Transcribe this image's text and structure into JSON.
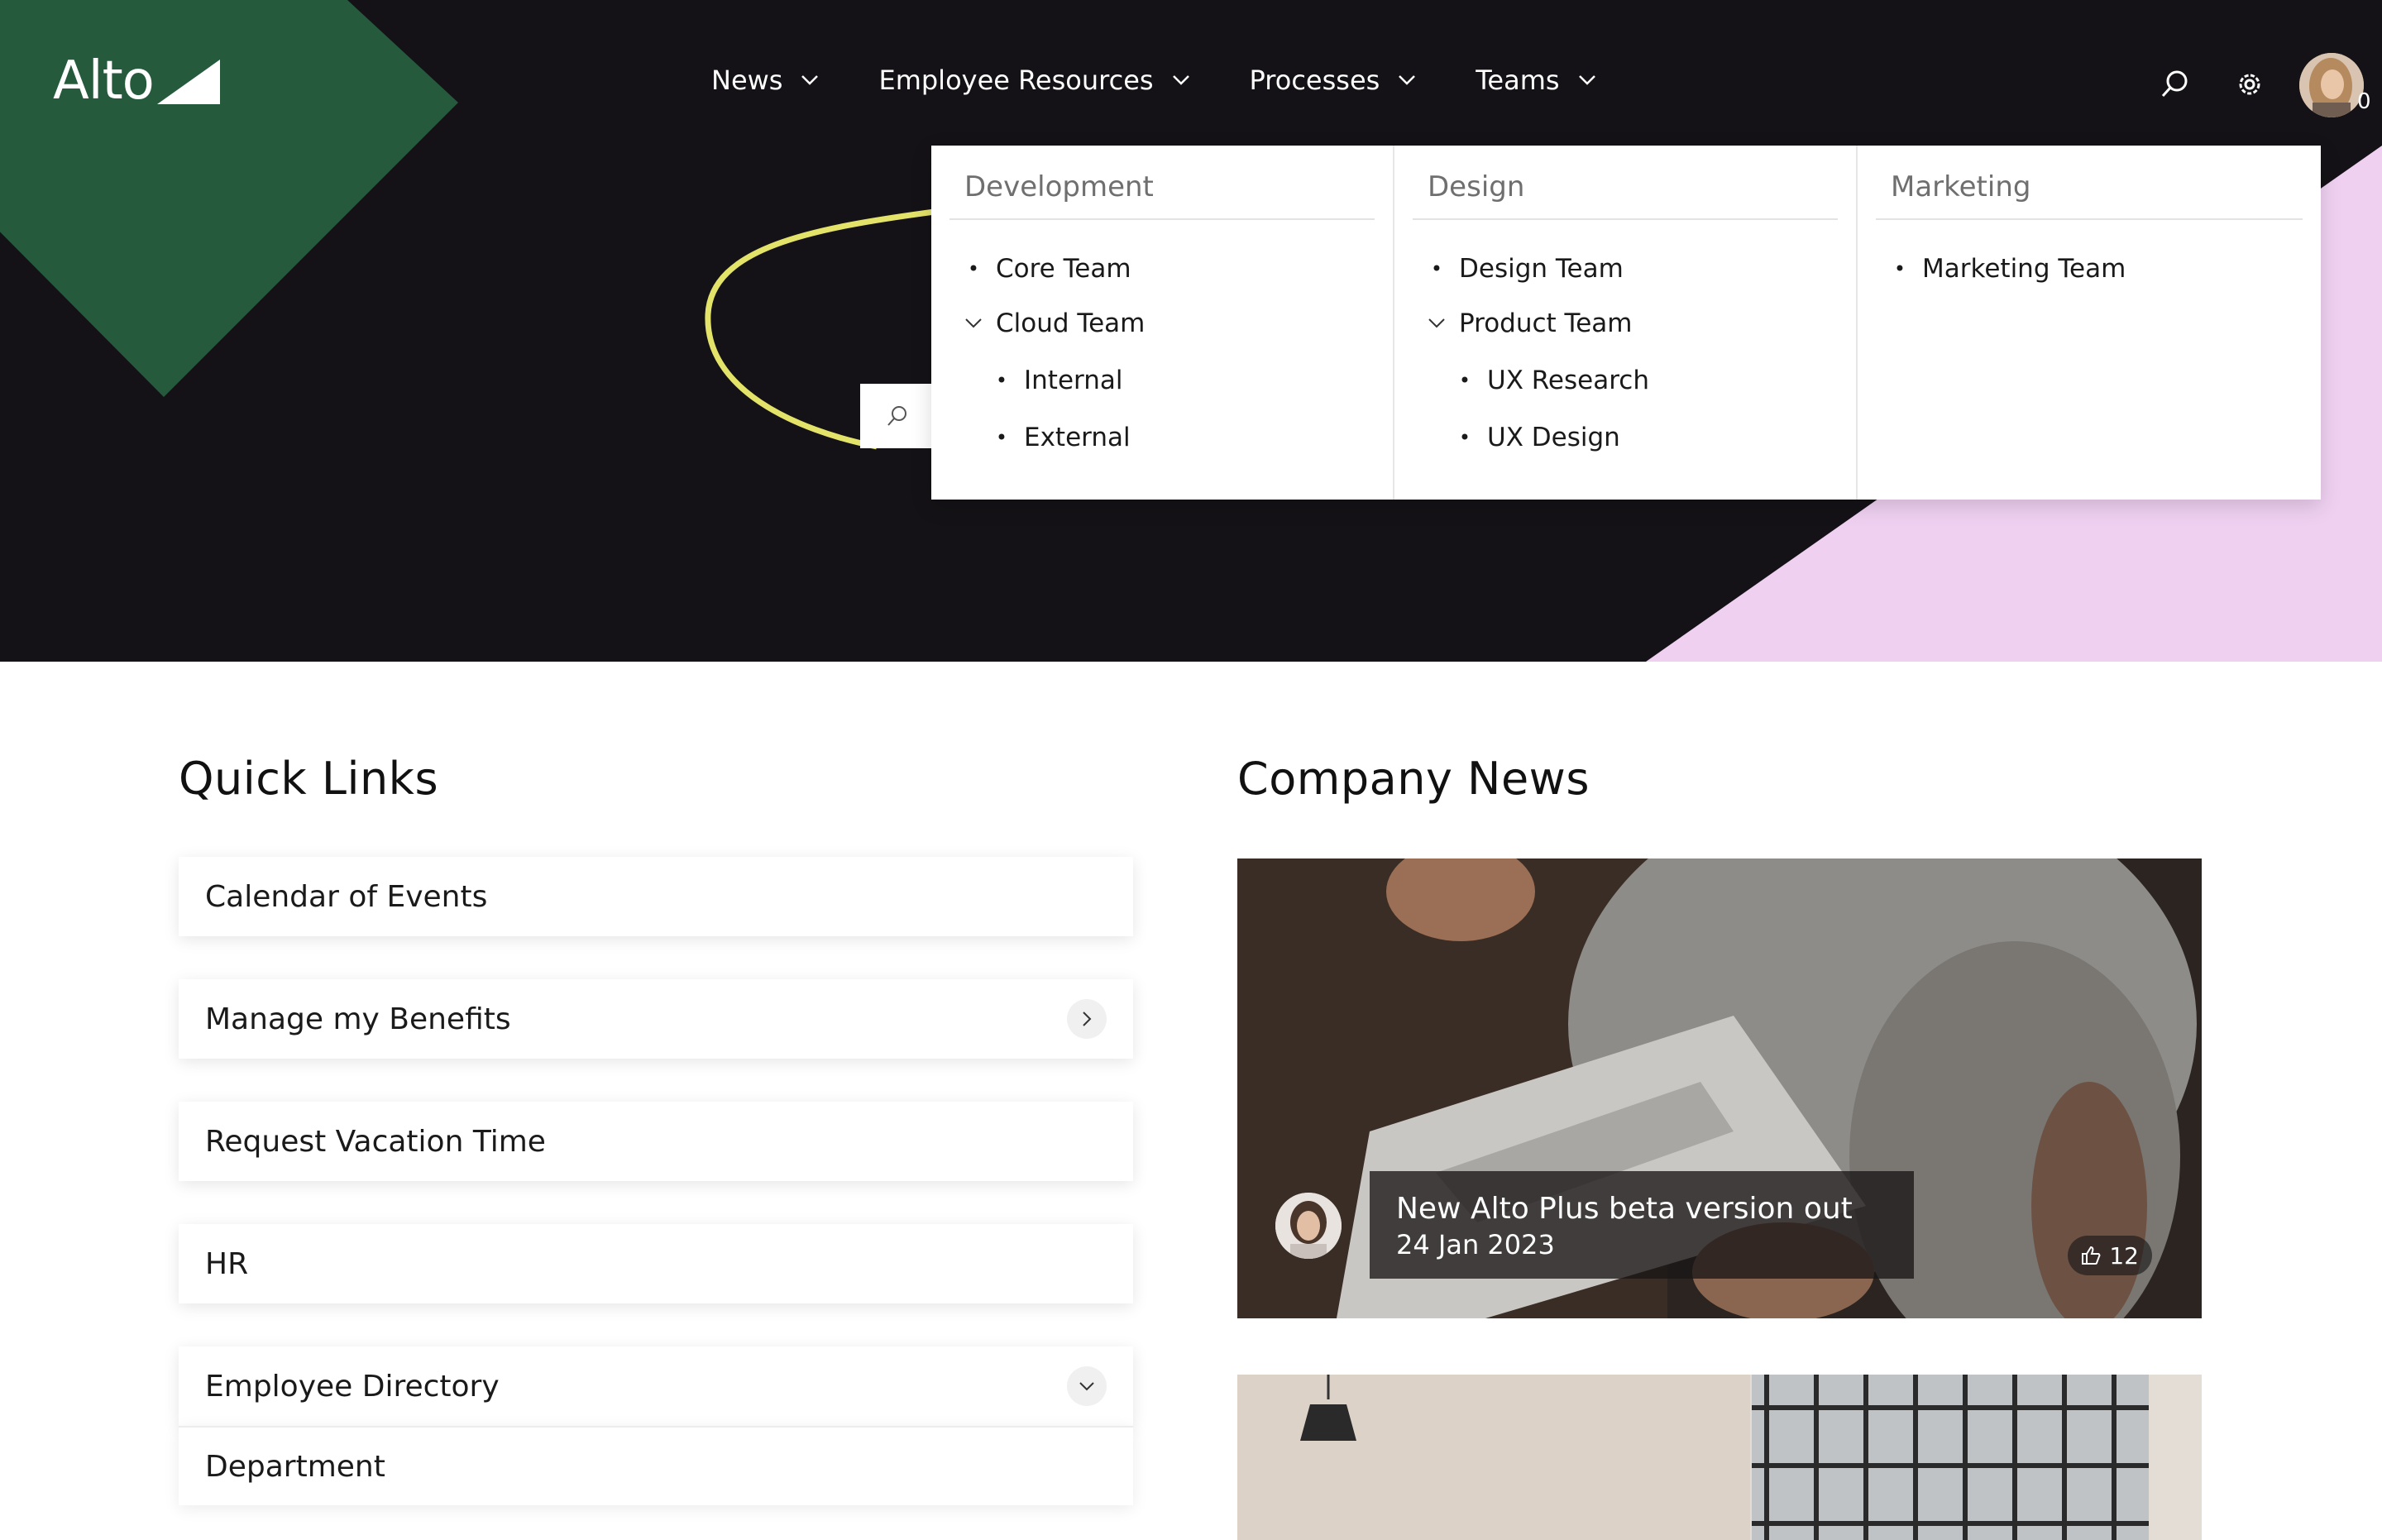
{
  "brand": {
    "name": "Alto"
  },
  "nav": {
    "items": [
      {
        "label": "News"
      },
      {
        "label": "Employee Resources"
      },
      {
        "label": "Processes"
      },
      {
        "label": "Teams"
      }
    ]
  },
  "user": {
    "notification_count": "0"
  },
  "mega_menu": {
    "columns": [
      {
        "heading": "Development",
        "items": [
          {
            "label": "Core Team"
          },
          {
            "label": "Cloud Team"
          }
        ],
        "subitems": [
          {
            "label": "Internal"
          },
          {
            "label": "External"
          }
        ]
      },
      {
        "heading": "Design",
        "items": [
          {
            "label": "Design Team"
          },
          {
            "label": "Product Team"
          }
        ],
        "subitems": [
          {
            "label": "UX Research"
          },
          {
            "label": "UX Design"
          }
        ]
      },
      {
        "heading": "Marketing",
        "items": [
          {
            "label": "Marketing Team"
          }
        ]
      }
    ]
  },
  "quick_links": {
    "title": "Quick Links",
    "items": [
      {
        "label": "Calendar of Events"
      },
      {
        "label": "Manage my Benefits"
      },
      {
        "label": "Request Vacation Time"
      },
      {
        "label": "HR"
      },
      {
        "label": "Employee Directory"
      }
    ],
    "sub_items": [
      {
        "label": "Department"
      }
    ]
  },
  "company_news": {
    "title": "Company News",
    "articles": [
      {
        "title": "New Alto Plus beta version out",
        "date": "24 Jan 2023",
        "likes": "12"
      }
    ]
  },
  "colors": {
    "hero_bg": "#141216",
    "green_diamond": "#255a3c",
    "pink_triangle": "#efd0f1",
    "yellow_line": "#e3e36a"
  },
  "icons": {
    "search": "search-icon",
    "settings": "gear-icon",
    "chevron": "chevron-down-icon",
    "like": "thumbs-up-icon"
  }
}
